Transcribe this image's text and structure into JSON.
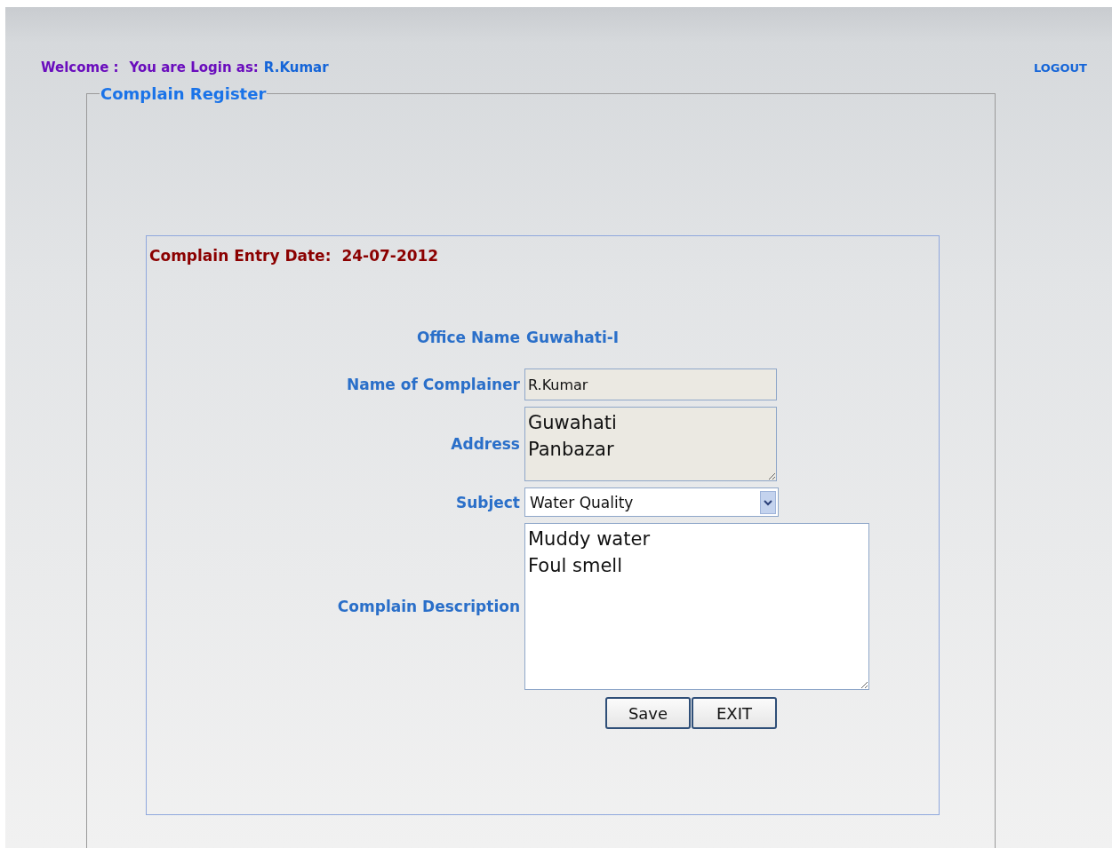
{
  "header": {
    "welcome": "Welcome :",
    "login_label": "You are Login as:",
    "user": "R.Kumar",
    "logout": "LOGOUT"
  },
  "form": {
    "legend": "Complain Register",
    "entry_date_label": "Complain Entry Date:",
    "entry_date": "24-07-2012",
    "office_label": "Office Name",
    "office": "Guwahati-I",
    "fields": [
      {
        "kind": "input",
        "label": "Name of Complainer",
        "value": "R.Kumar",
        "disabled": true
      },
      {
        "kind": "textarea",
        "label": "Address",
        "value": "Guwahati\nPanbazar",
        "disabled": true
      },
      {
        "kind": "select",
        "label": "Subject",
        "value": "Water Quality",
        "disabled": false
      },
      {
        "kind": "textarea",
        "label": "Complain Description",
        "value": "Muddy water\nFoul smell",
        "disabled": false
      }
    ],
    "buttons": [
      "Save",
      "EXIT"
    ]
  }
}
